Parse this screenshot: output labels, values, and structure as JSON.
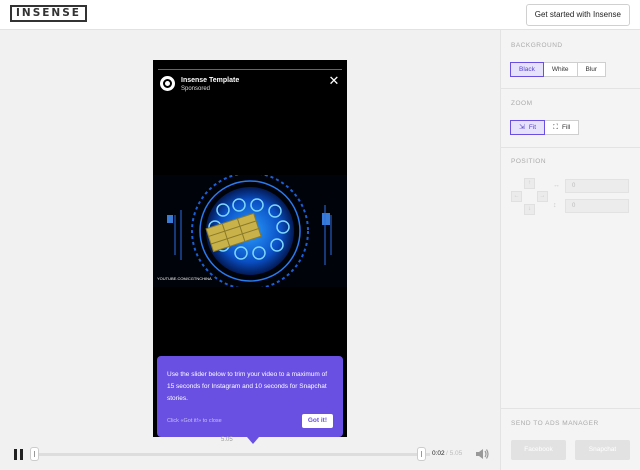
{
  "topbar": {
    "logo": "INSENSE",
    "cta_label": "Get started with Insense"
  },
  "story": {
    "account_name": "Insense Template",
    "sponsored": "Sponsored",
    "video_watermark": "YOUTUBE.COM/CGTNCHINA"
  },
  "tooltip": {
    "message": "Use the slider below to trim your video to a maximum of 15 seconds for Instagram and 10 seconds for Snapchat stories.",
    "hint": "Click «Got it!» to close",
    "button": "Got it!"
  },
  "player": {
    "trim_length": "5.05",
    "current_time": "0:02",
    "total_time": "/ 5.05"
  },
  "panel": {
    "background": {
      "title": "BACKGROUND",
      "options": [
        "Black",
        "White",
        "Blur"
      ],
      "selected": "Black"
    },
    "zoom": {
      "title": "ZOOM",
      "options": [
        "Fit",
        "Fill"
      ],
      "selected": "Fit"
    },
    "position": {
      "title": "POSITION",
      "x_value": "0",
      "y_value": "0"
    },
    "send": {
      "title": "SEND TO ADS MANAGER",
      "facebook": "Facebook",
      "snapchat": "Snapchat"
    }
  },
  "colors": {
    "accent": "#6a50e2",
    "accent_light": "#e6e2fb"
  }
}
